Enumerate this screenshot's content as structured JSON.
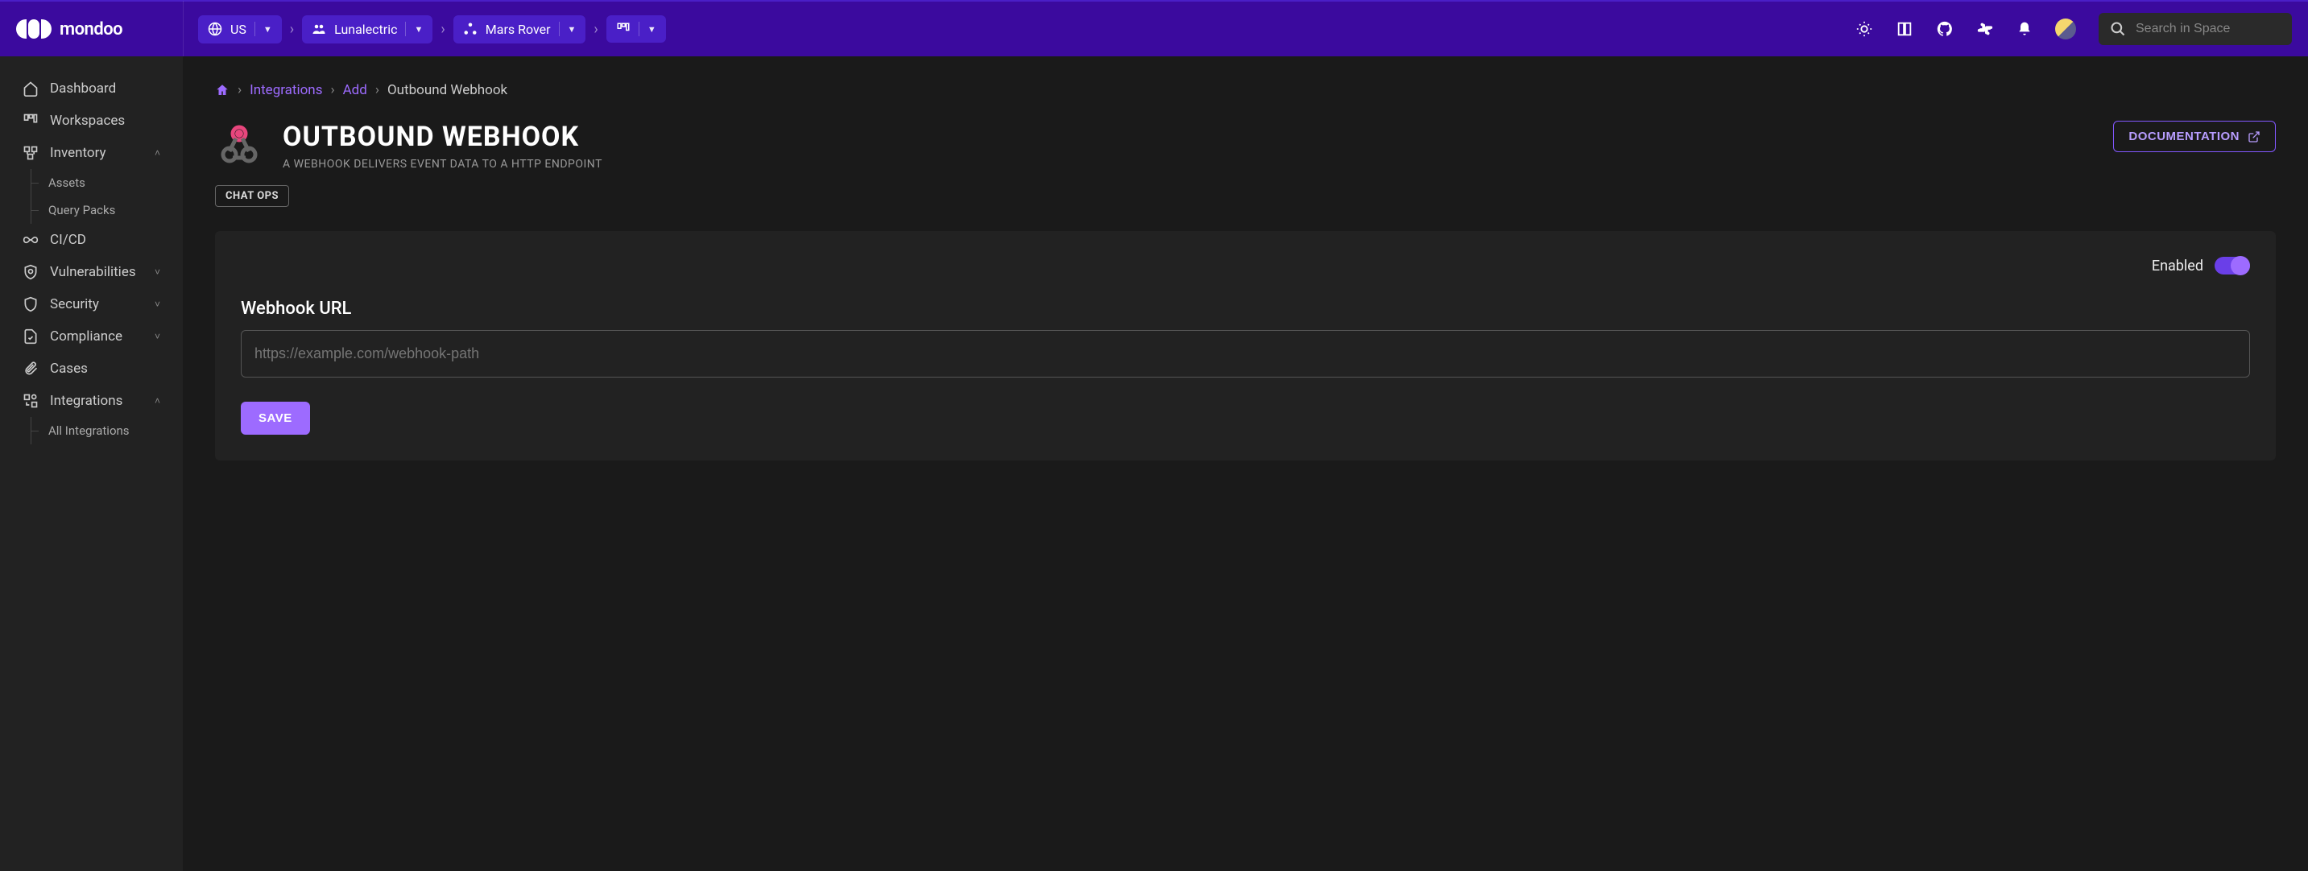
{
  "brand": "mondoo",
  "topnav": {
    "region": "US",
    "org": "Lunalectric",
    "space": "Mars Rover"
  },
  "search": {
    "placeholder": "Search in Space"
  },
  "sidebar": {
    "dashboard": "Dashboard",
    "workspaces": "Workspaces",
    "inventory": "Inventory",
    "inventory_sub": {
      "assets": "Assets",
      "querypacks": "Query Packs"
    },
    "cicd": "CI/CD",
    "vulnerabilities": "Vulnerabilities",
    "security": "Security",
    "compliance": "Compliance",
    "cases": "Cases",
    "integrations": "Integrations",
    "integrations_sub": {
      "all": "All Integrations"
    }
  },
  "breadcrumb": {
    "integrations": "Integrations",
    "add": "Add",
    "current": "Outbound Webhook"
  },
  "page": {
    "title": "OUTBOUND WEBHOOK",
    "subtitle": "A WEBHOOK DELIVERS EVENT DATA TO A HTTP ENDPOINT",
    "doc_button": "DOCUMENTATION",
    "tag": "CHAT OPS"
  },
  "form": {
    "enabled_label": "Enabled",
    "url_label": "Webhook URL",
    "url_placeholder": "https://example.com/webhook-path",
    "save": "SAVE"
  }
}
